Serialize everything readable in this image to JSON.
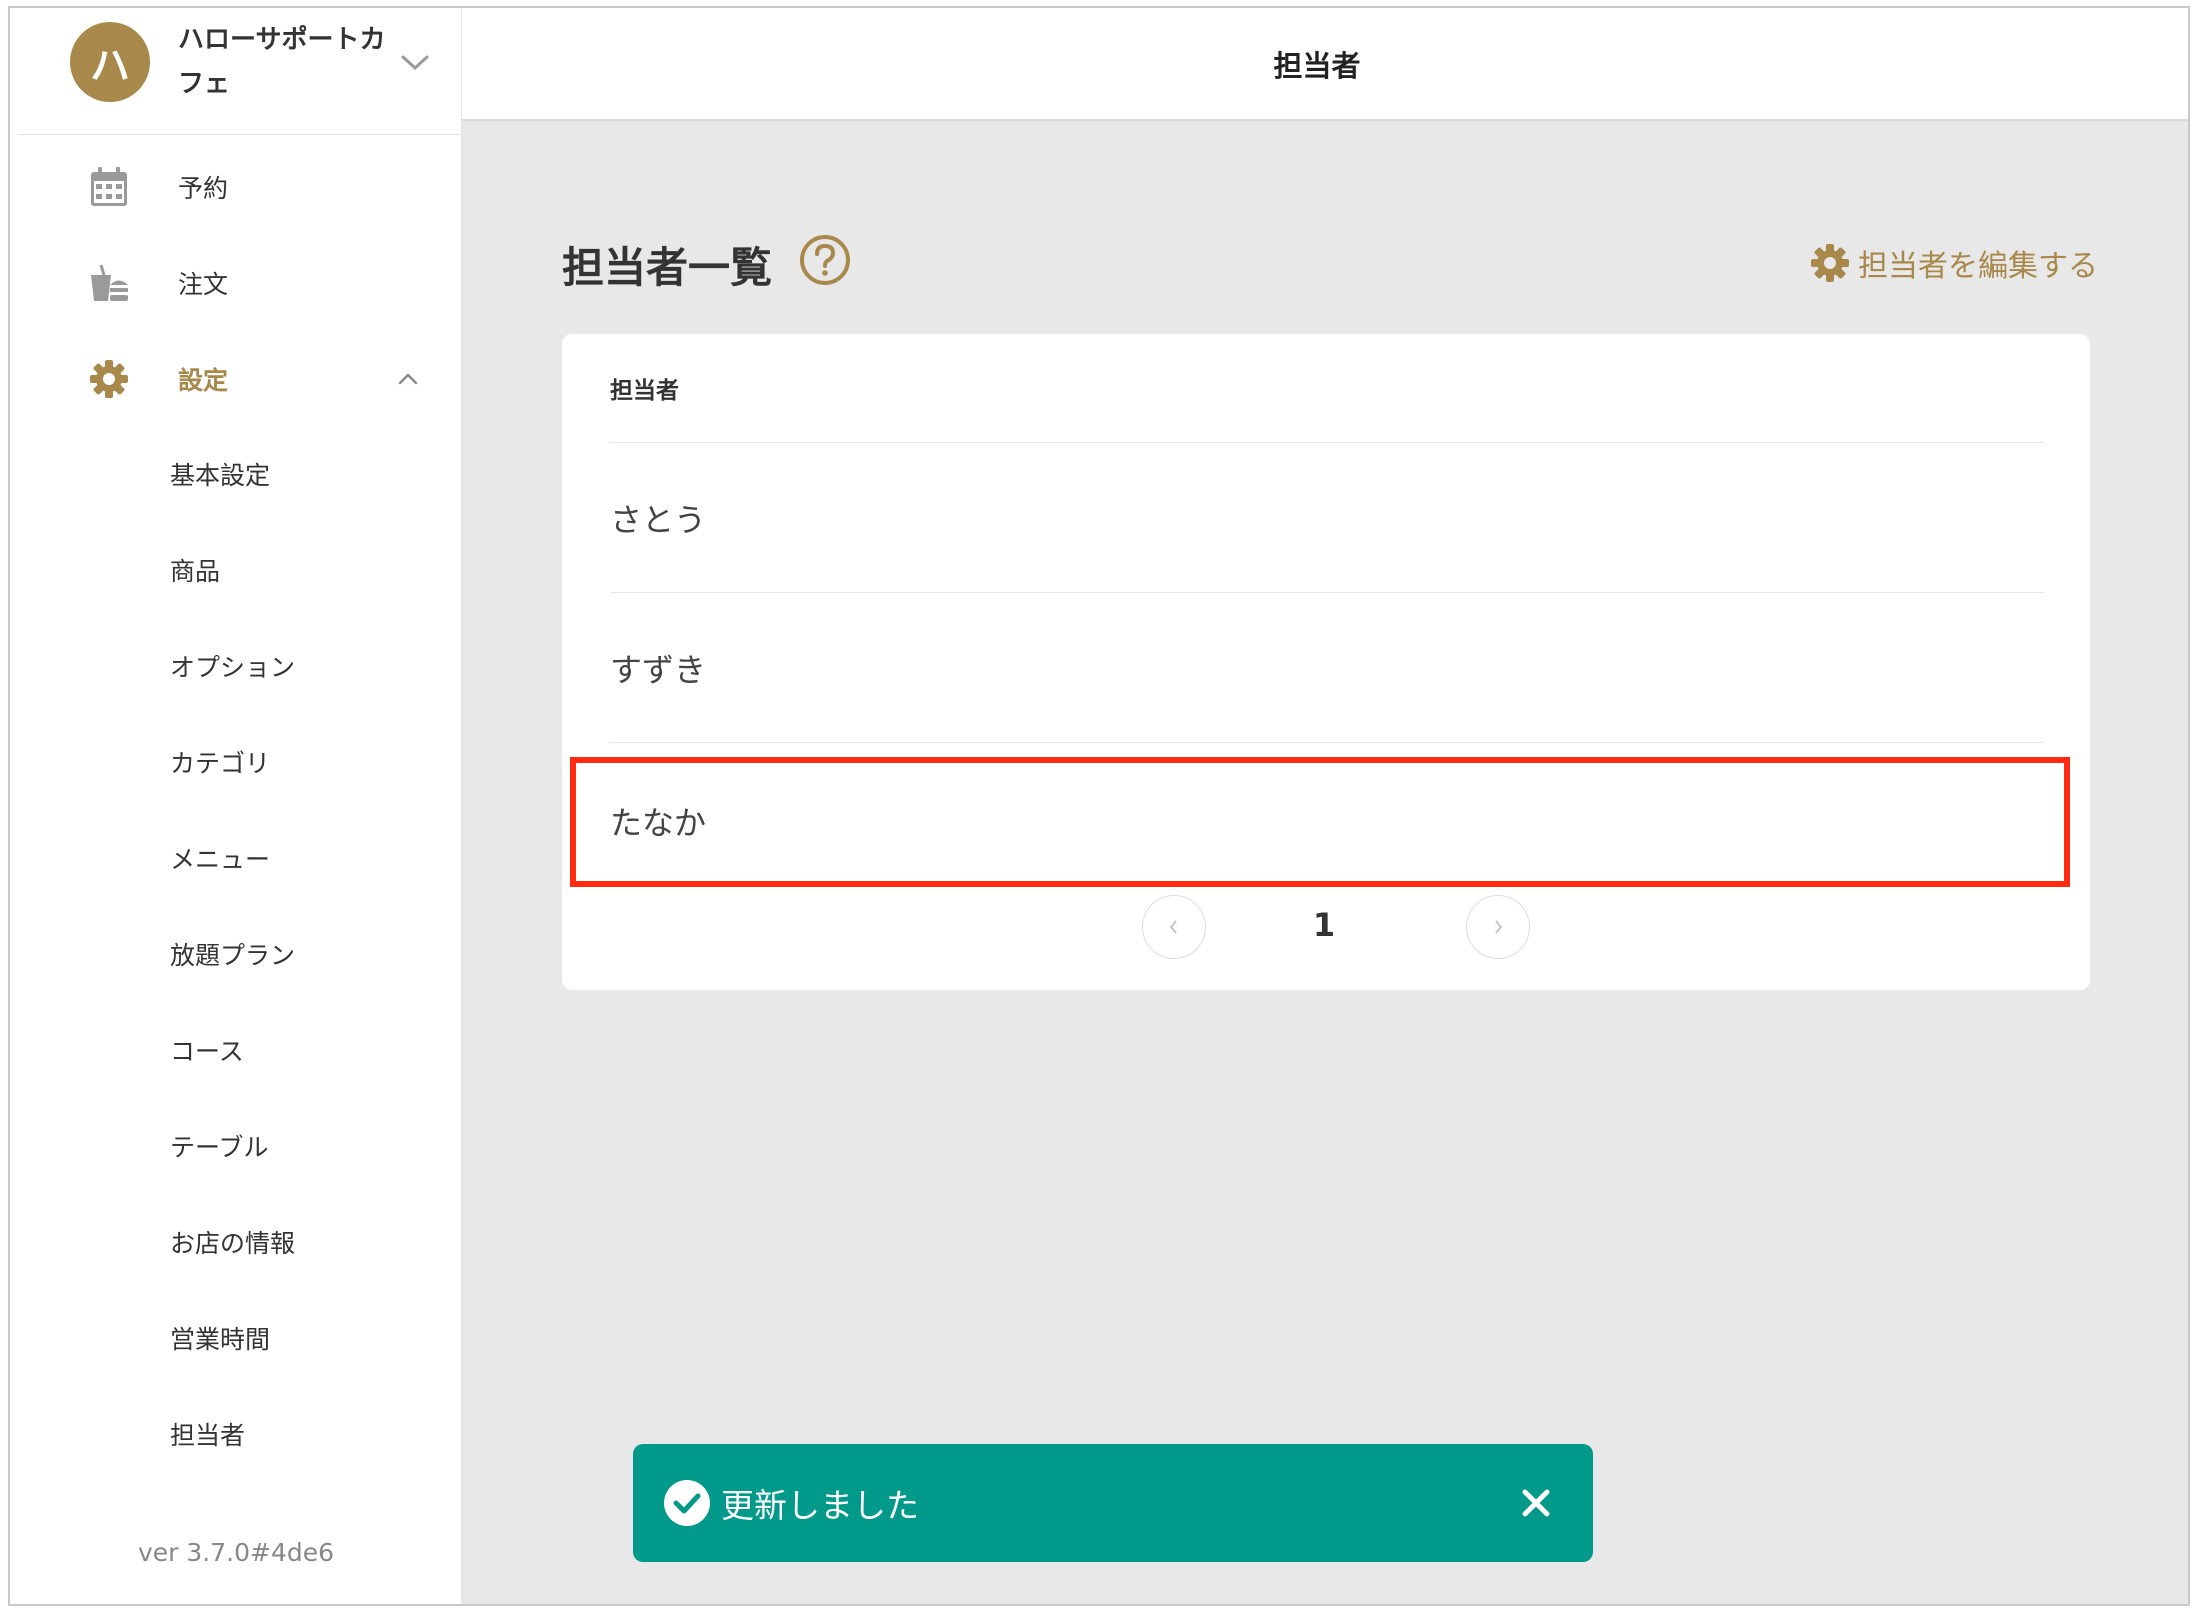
{
  "colors": {
    "accent": "#a8884b",
    "toast": "#00998a",
    "highlight": "#ff2a10"
  },
  "shop": {
    "avatar_letter": "ハ",
    "name_line1": "ハローサポートカ",
    "name_line2": "フェ"
  },
  "header": {
    "title": "担当者"
  },
  "sidebar": {
    "nav": [
      {
        "label": "予約",
        "icon": "calendar-icon"
      },
      {
        "label": "注文",
        "icon": "drink-burger-icon"
      },
      {
        "label": "設定",
        "icon": "gear-icon",
        "expanded": true
      }
    ],
    "settings_items": [
      "基本設定",
      "商品",
      "オプション",
      "カテゴリ",
      "メニュー",
      "放題プラン",
      "コース",
      "テーブル",
      "お店の情報",
      "営業時間",
      "担当者"
    ],
    "version": "ver 3.7.0#4de6"
  },
  "main": {
    "title": "担当者一覧",
    "edit_label": "担当者を編集する",
    "table": {
      "header": "担当者",
      "rows": [
        "さとう",
        "すずき",
        "たなか"
      ]
    },
    "pagination": {
      "current_page": "1"
    }
  },
  "toast": {
    "message": "更新しました"
  }
}
